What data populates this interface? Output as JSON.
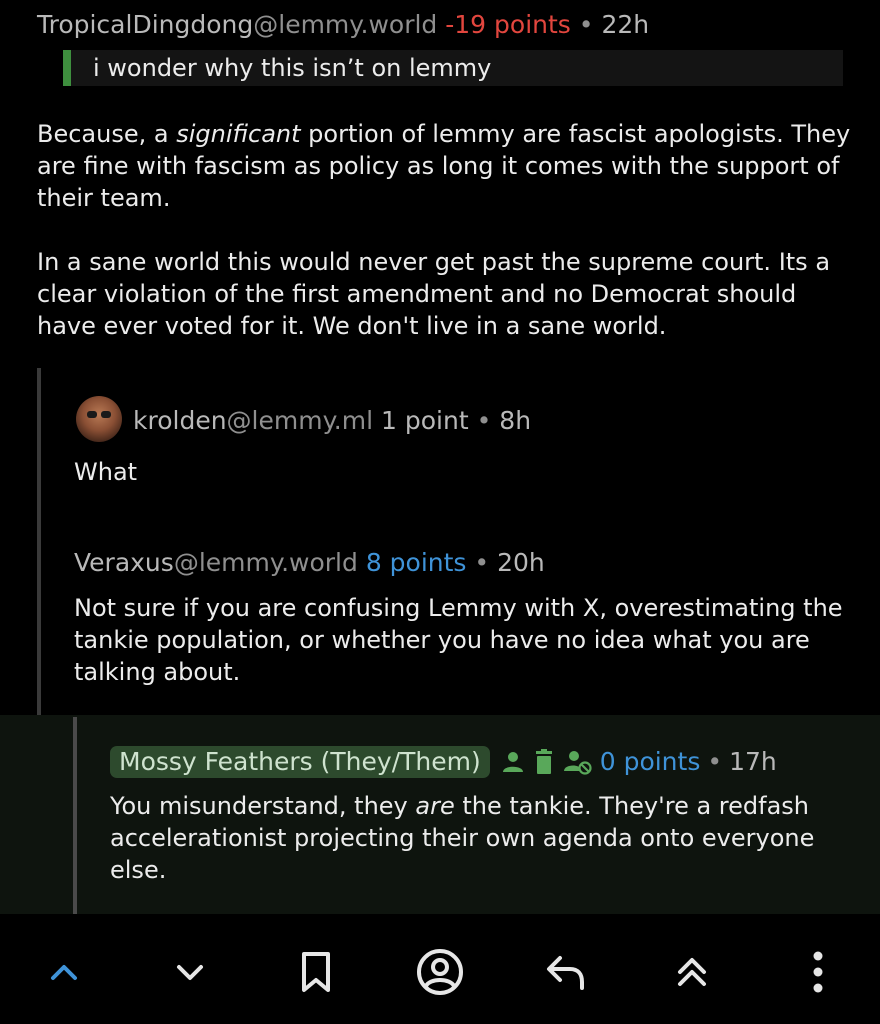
{
  "comments": [
    {
      "username": "TropicalDingdong",
      "instance": "@lemmy.world",
      "points": "-19 points",
      "separator": "•",
      "time": "22h",
      "quote": "i wonder why this isn’t on lemmy",
      "p1_pre": "Because, a ",
      "p1_em": "significant",
      "p1_post": " portion of lemmy are fascist apologists. They are fine with fascism as policy as long it comes with the support of their team.",
      "p2": "In a sane world this would never get past the supreme court. Its a clear violation of the first amendment and no Democrat should have ever voted for it. We don't live in a sane world."
    },
    {
      "username": "krolden",
      "instance": "@lemmy.ml",
      "points": "1 point",
      "separator": "•",
      "time": "8h",
      "body": "What"
    },
    {
      "username": "Veraxus",
      "instance": "@lemmy.world",
      "points": "8 points",
      "separator": "•",
      "time": "20h",
      "body": "Not sure if you are confusing Lemmy with X, overestimating the tankie population, or whether you have no idea what you are talking about."
    },
    {
      "username": "Mossy Feathers (They/Them)",
      "points": "0 points",
      "separator": "•",
      "time": "17h",
      "badge_icons": [
        "person-icon",
        "trash-icon",
        "person-block-icon"
      ],
      "body_pre": "You misunderstand, they ",
      "body_em": "are",
      "body_post": " the tankie. They're a redfash accelerationist projecting their own agenda onto everyone else."
    }
  ],
  "bottom_nav": [
    "chevron-up-icon",
    "chevron-down-icon",
    "bookmark-icon",
    "account-circle-icon",
    "reply-icon",
    "double-chevron-up-icon",
    "more-vertical-icon"
  ],
  "colors": {
    "background": "#000000",
    "negative_points": "#e2463e",
    "positive_points": "#3f93d8",
    "quote_bar": "#3e8f3e",
    "highlight_bg": "#0e140e",
    "name_pill": "#2d4a2d",
    "mod_icon": "#59a85a"
  }
}
